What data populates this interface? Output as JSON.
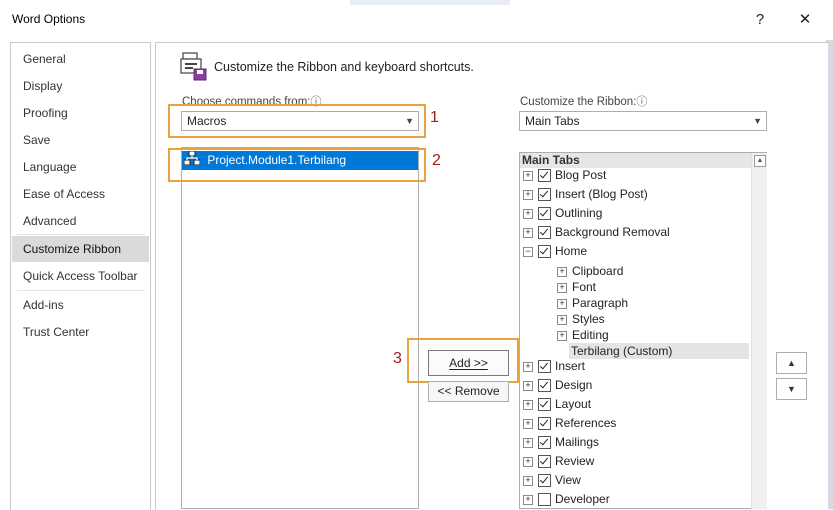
{
  "window": {
    "title": "Word Options",
    "help": "?",
    "close": "✕"
  },
  "sidebar": {
    "items": [
      {
        "label": "General"
      },
      {
        "label": "Display"
      },
      {
        "label": "Proofing"
      },
      {
        "label": "Save"
      },
      {
        "label": "Language"
      },
      {
        "label": "Ease of Access"
      },
      {
        "label": "Advanced"
      },
      {
        "label": "Customize Ribbon"
      },
      {
        "label": "Quick Access Toolbar"
      },
      {
        "label": "Add-ins"
      },
      {
        "label": "Trust Center"
      }
    ],
    "selected": "Customize Ribbon"
  },
  "main": {
    "header": "Customize the Ribbon and keyboard shortcuts.",
    "choose_label": "Choose commands from:",
    "info_glyph": "ⓘ",
    "choose_value": "Macros",
    "commands": [
      "Project.Module1.Terbilang"
    ],
    "customize_label": "Customize the Ribbon:",
    "customize_value": "Main Tabs",
    "add_label": "Add >>",
    "remove_label": "<< Remove",
    "annotations": [
      "1",
      "2",
      "3"
    ],
    "tree_header": "Main Tabs",
    "tree": {
      "blog_post": "Blog Post",
      "insert_blog": "Insert (Blog Post)",
      "outlining": "Outlining",
      "bg_removal": "Background Removal",
      "home": "Home",
      "clipboard": "Clipboard",
      "font": "Font",
      "paragraph": "Paragraph",
      "styles": "Styles",
      "editing": "Editing",
      "terbilang": "Terbilang (Custom)",
      "insert": "Insert",
      "design": "Design",
      "layout": "Layout",
      "references": "References",
      "mailings": "Mailings",
      "review": "Review",
      "view": "View",
      "developer": "Developer"
    },
    "expand_glyph": "+",
    "collapse_glyph": "−",
    "move_up": "▲",
    "move_down": "▼"
  }
}
